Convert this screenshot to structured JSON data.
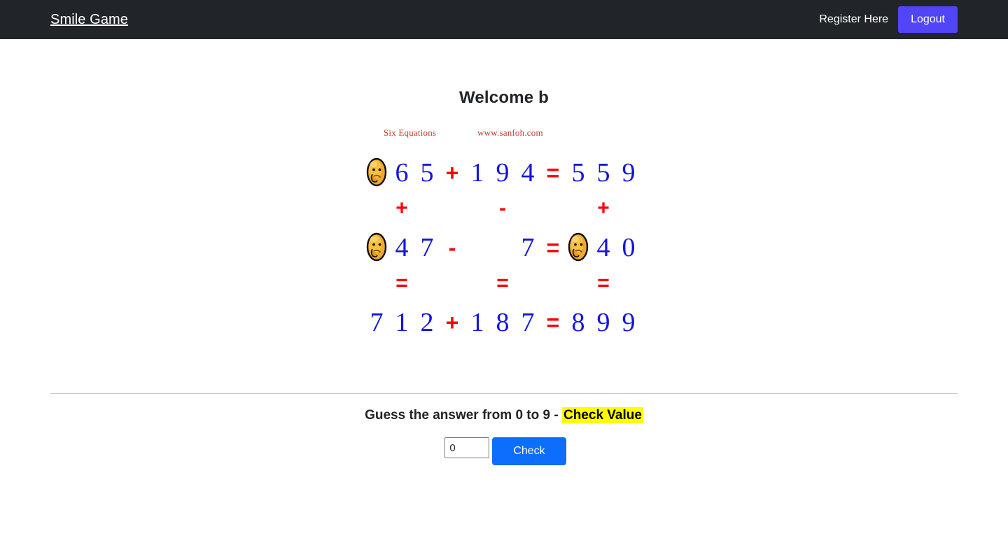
{
  "navbar": {
    "brand": "Smile Game",
    "register_label": "Register Here",
    "logout_label": "Logout",
    "background": "#212529",
    "logout_color": "#5145f5"
  },
  "main": {
    "welcome_title": "Welcome b"
  },
  "puzzle": {
    "credit_label": "Six Equations",
    "credit_url": "www.sanfoh.com",
    "credit_color": "#c0392b",
    "digit_color": "#1414e0",
    "operator_color": "#ff0000",
    "face_icon": "thinking-face-icon",
    "rows": [
      {
        "type": "equation",
        "cells": [
          "face",
          "6",
          "5",
          "+",
          "1",
          "9",
          "4",
          "=",
          "5",
          "5",
          "9"
        ]
      },
      {
        "type": "operators",
        "cells": [
          "",
          "+",
          "",
          "",
          "",
          "-",
          "",
          "",
          "",
          "+",
          ""
        ]
      },
      {
        "type": "equation",
        "cells": [
          "face",
          "4",
          "7",
          "-",
          "",
          "",
          "7",
          "=",
          "face",
          "4",
          "0"
        ]
      },
      {
        "type": "operators",
        "cells": [
          "",
          "=",
          "",
          "",
          "",
          "=",
          "",
          "",
          "",
          "=",
          ""
        ]
      },
      {
        "type": "equation",
        "cells": [
          "7",
          "1",
          "2",
          "+",
          "1",
          "8",
          "7",
          "=",
          "8",
          "9",
          "9"
        ]
      }
    ]
  },
  "guess": {
    "prompt_prefix": "Guess the answer from 0 to 9 - ",
    "highlight_text": "Check Value",
    "highlight_color": "#ffff00",
    "input_value": "0",
    "input_placeholder": "",
    "check_label": "Check",
    "check_color": "#0d6efd"
  }
}
